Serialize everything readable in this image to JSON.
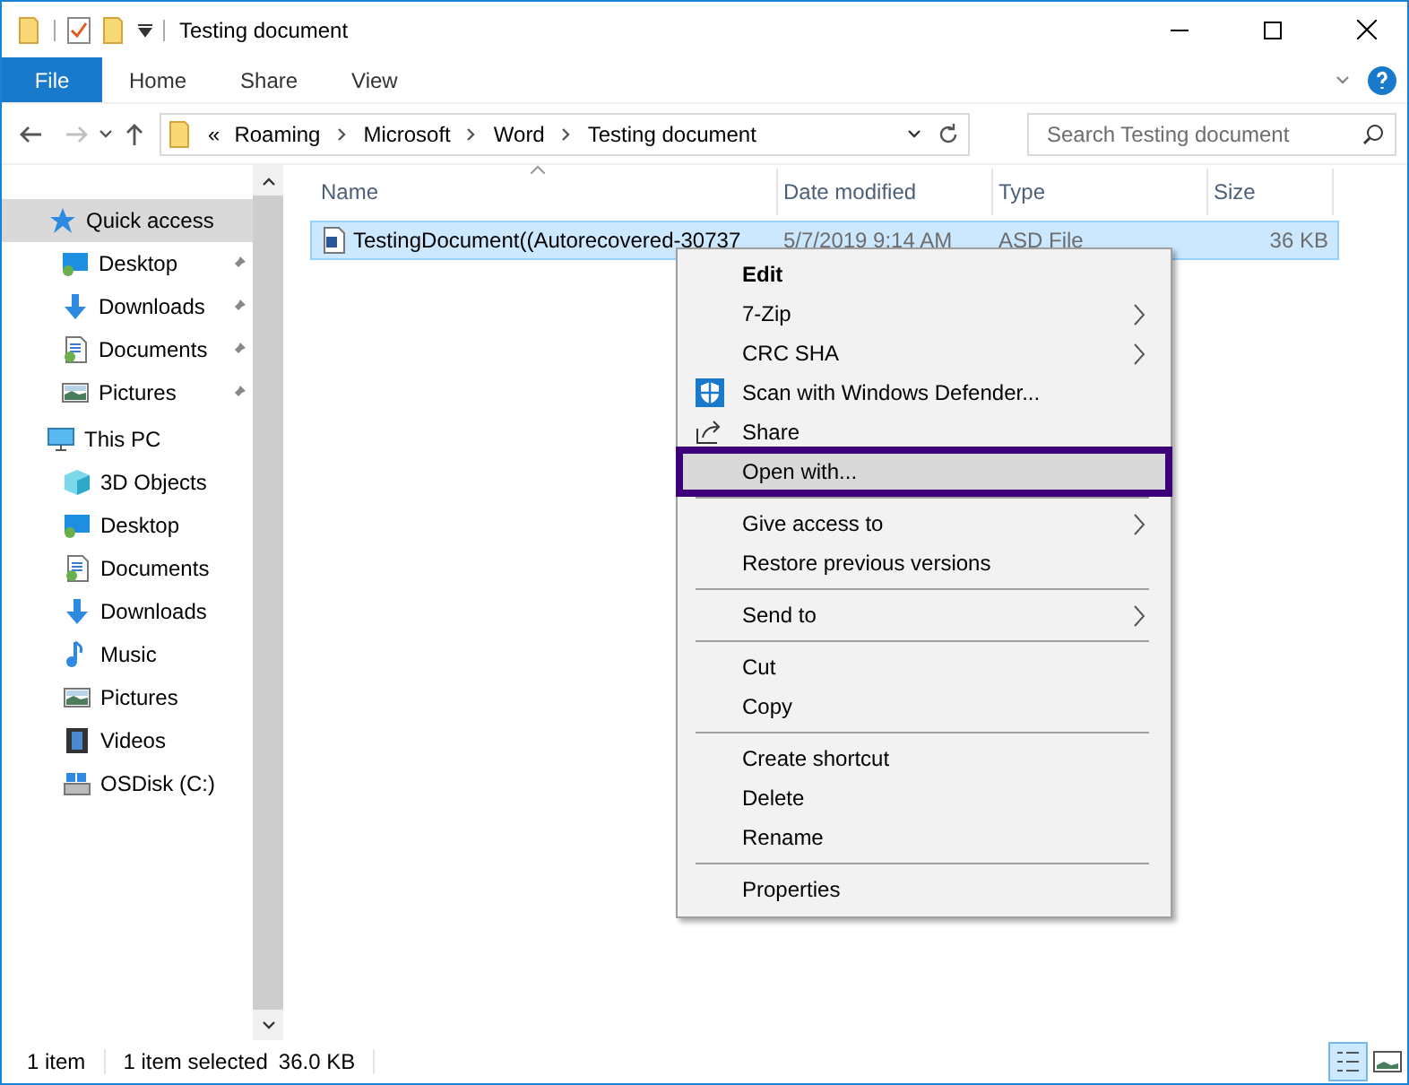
{
  "window": {
    "title": "Testing document"
  },
  "ribbon_tabs": [
    {
      "label": "File",
      "selected": true
    },
    {
      "label": "Home",
      "selected": false
    },
    {
      "label": "Share",
      "selected": false
    },
    {
      "label": "View",
      "selected": false
    }
  ],
  "address": {
    "overflow": "«",
    "crumbs": [
      "Roaming",
      "Microsoft",
      "Word",
      "Testing document"
    ]
  },
  "search": {
    "placeholder": "Search Testing document"
  },
  "sidebar": [
    {
      "label": "Quick access",
      "kind": "star",
      "selected": true,
      "children": [
        {
          "label": "Desktop",
          "kind": "desktop",
          "pinned": true,
          "selected": false
        },
        {
          "label": "Downloads",
          "kind": "downloads",
          "pinned": true,
          "selected": false
        },
        {
          "label": "Documents",
          "kind": "documents",
          "pinned": true,
          "selected": false
        },
        {
          "label": "Pictures",
          "kind": "pictures",
          "pinned": true,
          "selected": false
        }
      ]
    },
    {
      "label": "This PC",
      "kind": "pc",
      "selected": false,
      "children": [
        {
          "label": "3D Objects",
          "kind": "objects",
          "pinned": false,
          "selected": false
        },
        {
          "label": "Desktop",
          "kind": "desktop",
          "pinned": false,
          "selected": false
        },
        {
          "label": "Documents",
          "kind": "documents",
          "pinned": false,
          "selected": false
        },
        {
          "label": "Downloads",
          "kind": "downloads",
          "pinned": false,
          "selected": false
        },
        {
          "label": "Music",
          "kind": "music",
          "pinned": false,
          "selected": false
        },
        {
          "label": "Pictures",
          "kind": "pictures",
          "pinned": false,
          "selected": false
        },
        {
          "label": "Videos",
          "kind": "videos",
          "pinned": false,
          "selected": false
        },
        {
          "label": "OSDisk (C:)",
          "kind": "disk",
          "pinned": false,
          "selected": false
        }
      ]
    }
  ],
  "table": {
    "columns": [
      "Name",
      "Date modified",
      "Type",
      "Size"
    ],
    "rows": [
      {
        "name": "TestingDocument((Autorecovered-30737",
        "date": "5/7/2019 9:14 AM",
        "type": "ASD File",
        "size": "36 KB",
        "selected": true
      }
    ]
  },
  "context_menu": [
    {
      "kind": "plain",
      "label": "Edit",
      "default": true,
      "submenu": false,
      "selected": false
    },
    {
      "kind": "plain",
      "label": "7-Zip",
      "default": false,
      "submenu": true,
      "selected": false
    },
    {
      "kind": "plain",
      "label": "CRC SHA",
      "default": false,
      "submenu": true,
      "selected": false
    },
    {
      "kind": "shield",
      "label": "Scan with Windows Defender...",
      "default": false,
      "submenu": false,
      "selected": false
    },
    {
      "kind": "share",
      "label": "Share",
      "default": false,
      "submenu": false,
      "selected": false
    },
    {
      "kind": "plain",
      "label": "Open with...",
      "default": false,
      "submenu": false,
      "selected": true
    },
    {
      "kind": "separator"
    },
    {
      "kind": "plain",
      "label": "Give access to",
      "default": false,
      "submenu": true,
      "selected": false
    },
    {
      "kind": "plain",
      "label": "Restore previous versions",
      "default": false,
      "submenu": false,
      "selected": false
    },
    {
      "kind": "separator"
    },
    {
      "kind": "plain",
      "label": "Send to",
      "default": false,
      "submenu": true,
      "selected": false
    },
    {
      "kind": "separator"
    },
    {
      "kind": "plain",
      "label": "Cut",
      "default": false,
      "submenu": false,
      "selected": false
    },
    {
      "kind": "plain",
      "label": "Copy",
      "default": false,
      "submenu": false,
      "selected": false
    },
    {
      "kind": "separator"
    },
    {
      "kind": "plain",
      "label": "Create shortcut",
      "default": false,
      "submenu": false,
      "selected": false
    },
    {
      "kind": "plain",
      "label": "Delete",
      "default": false,
      "submenu": false,
      "selected": false
    },
    {
      "kind": "plain",
      "label": "Rename",
      "default": false,
      "submenu": false,
      "selected": false
    },
    {
      "kind": "separator"
    },
    {
      "kind": "plain",
      "label": "Properties",
      "default": false,
      "submenu": false,
      "selected": false
    }
  ],
  "status_bar": {
    "count": "1 item",
    "selection": "1 item selected",
    "size": "36.0 KB",
    "views": [
      {
        "kind": "details",
        "selected": true
      },
      {
        "kind": "large",
        "selected": false
      }
    ]
  }
}
